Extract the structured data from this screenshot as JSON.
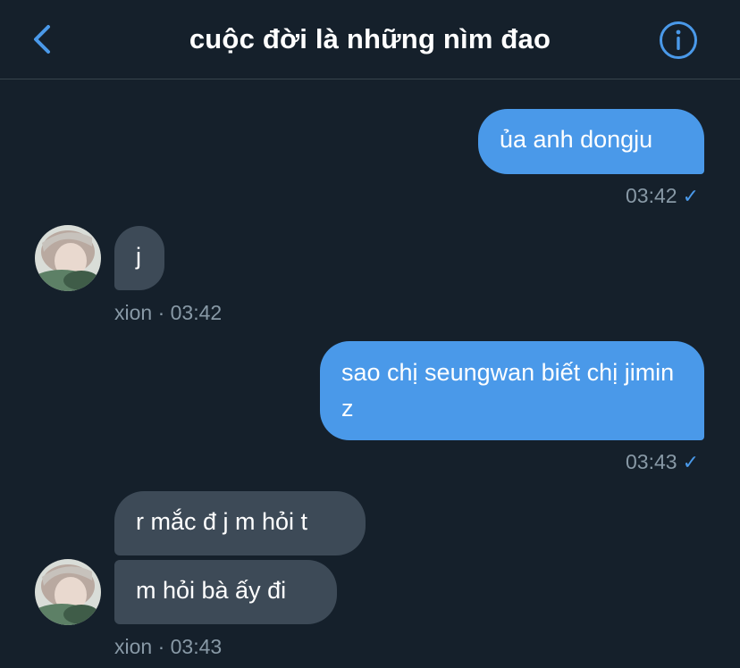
{
  "header": {
    "title": "cuộc đời là những nìm đao"
  },
  "messages": {
    "m1": {
      "text": "ủa anh dongju",
      "time": "03:42"
    },
    "m2": {
      "text": "j",
      "meta": "xion · 03:42"
    },
    "m3": {
      "text": "sao chị seungwan biết chị jimin z",
      "time": "03:43"
    },
    "m4": {
      "text": "r mắc đ j m hỏi t"
    },
    "m5": {
      "text": "m hỏi bà ấy đi",
      "meta": "xion · 03:43"
    }
  },
  "icons": {
    "back": "chevron-left-icon",
    "info": "info-icon",
    "read": "checkmark-icon"
  },
  "colors": {
    "background": "#15202b",
    "accent": "#4a99e9",
    "incoming_bubble": "#3d4a57",
    "meta_text": "#8899a6"
  }
}
